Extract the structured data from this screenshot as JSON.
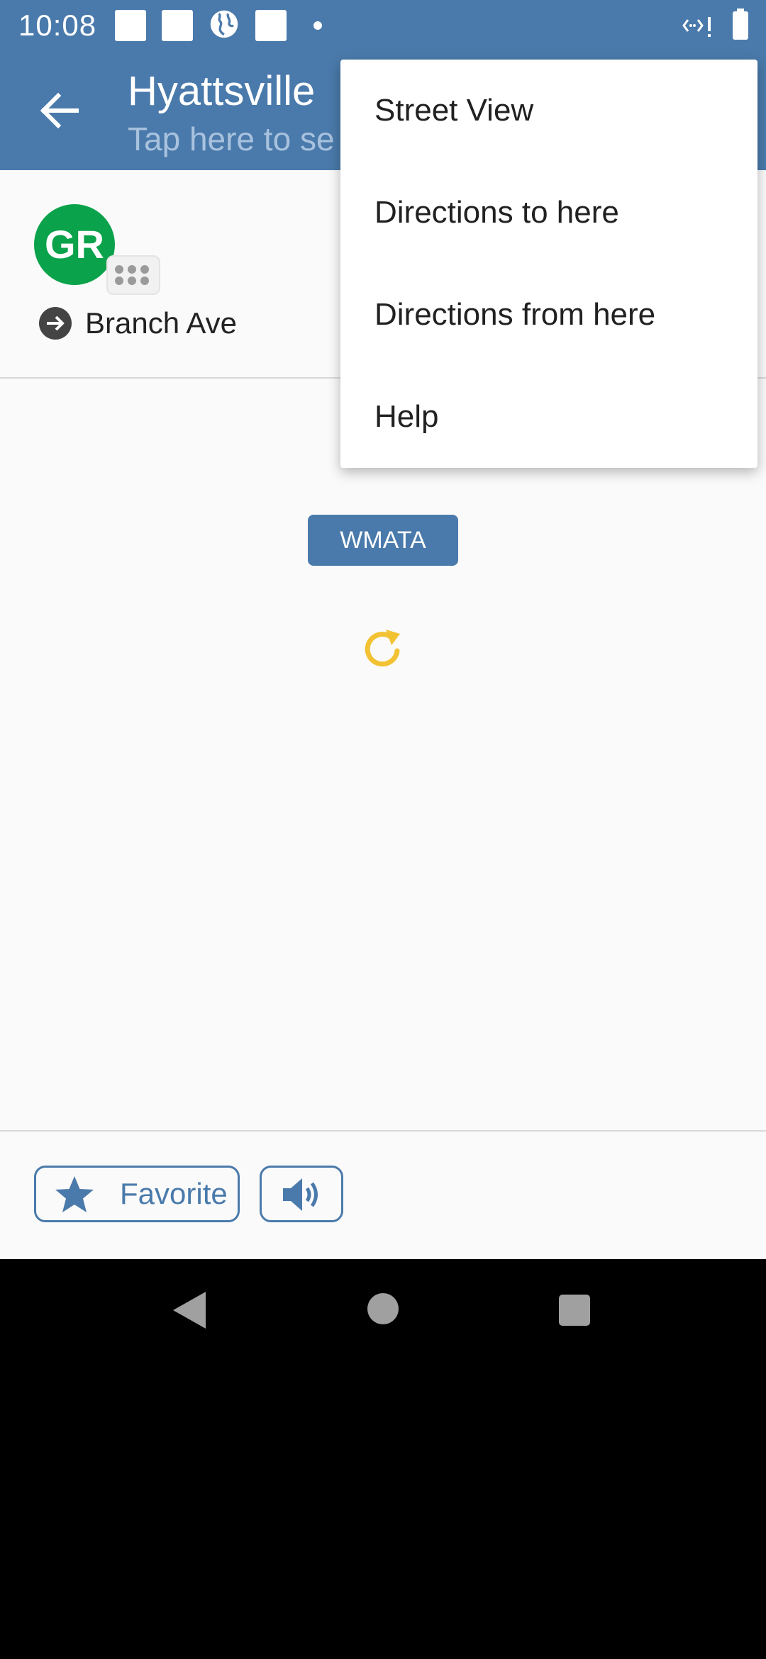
{
  "status_bar": {
    "time": "10:08",
    "icons": [
      "notification-square-icon",
      "notification-square-icon",
      "globe-icon",
      "notification-square-icon",
      "dot-icon",
      "signal-icon",
      "battery-icon"
    ]
  },
  "toolbar": {
    "title": "Hyattsville",
    "subtitle": "Tap here to se"
  },
  "route": {
    "short_name": "GR",
    "color": "#0aa24a",
    "direction": "Branch Ave"
  },
  "agency": {
    "name": "WMATA"
  },
  "refresh": {
    "color": "#f2c232"
  },
  "actions": {
    "favorite_label": "Favorite"
  },
  "menu": {
    "items": [
      {
        "label": "Street View"
      },
      {
        "label": "Directions to here"
      },
      {
        "label": "Directions from here"
      },
      {
        "label": "Help"
      }
    ]
  },
  "theme": {
    "primary": "#4a7aab",
    "background": "#fafafa"
  }
}
